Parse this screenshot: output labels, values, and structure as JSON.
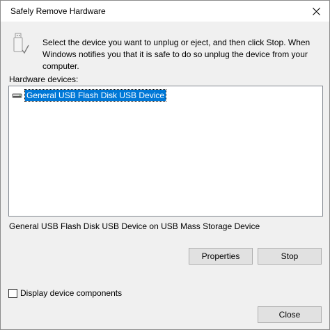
{
  "window": {
    "title": "Safely Remove Hardware",
    "close_glyph": "✕"
  },
  "icons": {
    "header_icon": "usb-drive-check-icon",
    "device_icon": "usb-drive-icon",
    "close_icon": "close-icon"
  },
  "instructions": "Select the device you want to unplug or eject, and then click Stop. When Windows notifies you that it is safe to do so unplug the device from your computer.",
  "hardware_list": {
    "label": "Hardware devices:",
    "items": [
      {
        "name": "General USB Flash Disk USB Device",
        "selected": true
      }
    ]
  },
  "status_text": "General USB Flash Disk USB Device on USB Mass Storage Device",
  "buttons": {
    "properties": "Properties",
    "stop": "Stop",
    "close": "Close"
  },
  "checkbox": {
    "label": "Display device components",
    "checked": false
  },
  "colors": {
    "selection": "#0078d7",
    "dialog_bg": "#f0f0f0",
    "button_bg": "#e1e1e1"
  }
}
